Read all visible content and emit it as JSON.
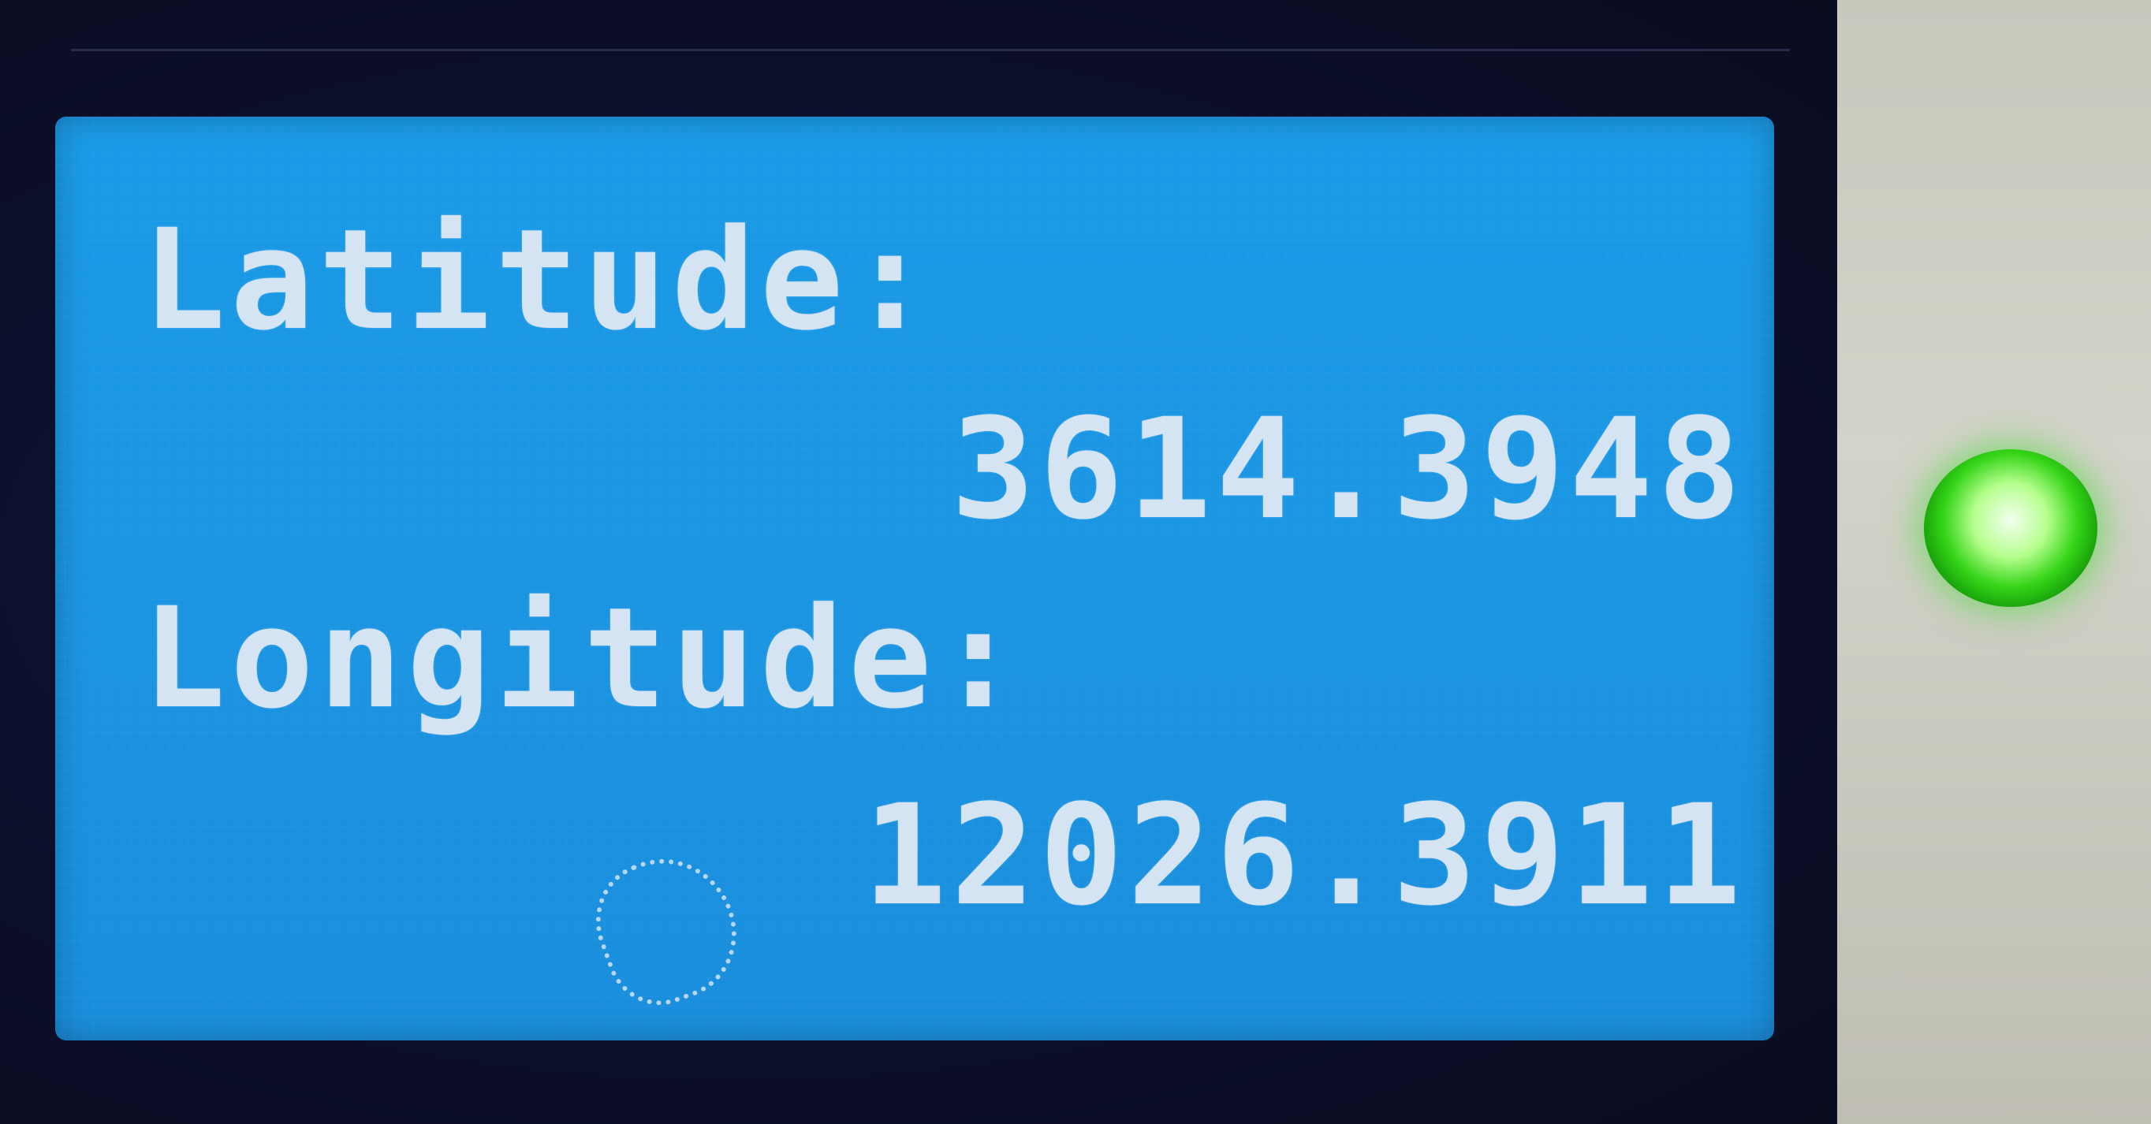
{
  "display": {
    "latitude_label": "Latitude:",
    "latitude_value": "3614.3948",
    "longitude_label": "Longitude:",
    "longitude_value": "12026.3911"
  },
  "colors": {
    "screen_background": "#1a9ae6",
    "text": "#d4e4f2",
    "bezel": "#0c0f2a",
    "led": "#34d417"
  },
  "icons": {
    "status_led": "green-led-icon"
  }
}
